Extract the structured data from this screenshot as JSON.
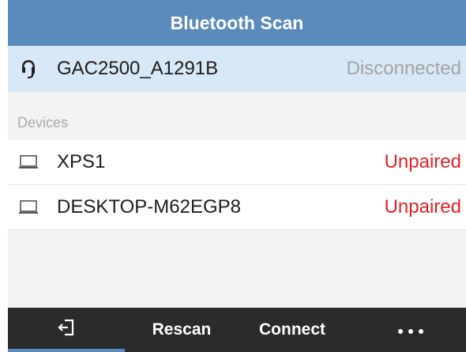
{
  "title": "Bluetooth Scan",
  "connected_device": {
    "name": "GAC2500_A1291B",
    "status": "Disconnected",
    "icon": "headset-icon"
  },
  "devices_section": {
    "label": "Devices",
    "items": [
      {
        "name": "XPS1",
        "status": "Unpaired",
        "icon": "laptop-icon"
      },
      {
        "name": "DESKTOP-M62EGP8",
        "status": "Unpaired",
        "icon": "laptop-icon"
      }
    ]
  },
  "bottom_bar": {
    "back_icon": "exit-icon",
    "rescan_label": "Rescan",
    "connect_label": "Connect",
    "more_icon": "more-dots-icon"
  },
  "colors": {
    "title_bar": "#5b8bbd",
    "highlight_row": "#d7e8f7",
    "unpaired_status": "#e52025",
    "bottom_bar": "#2b2b2b"
  }
}
